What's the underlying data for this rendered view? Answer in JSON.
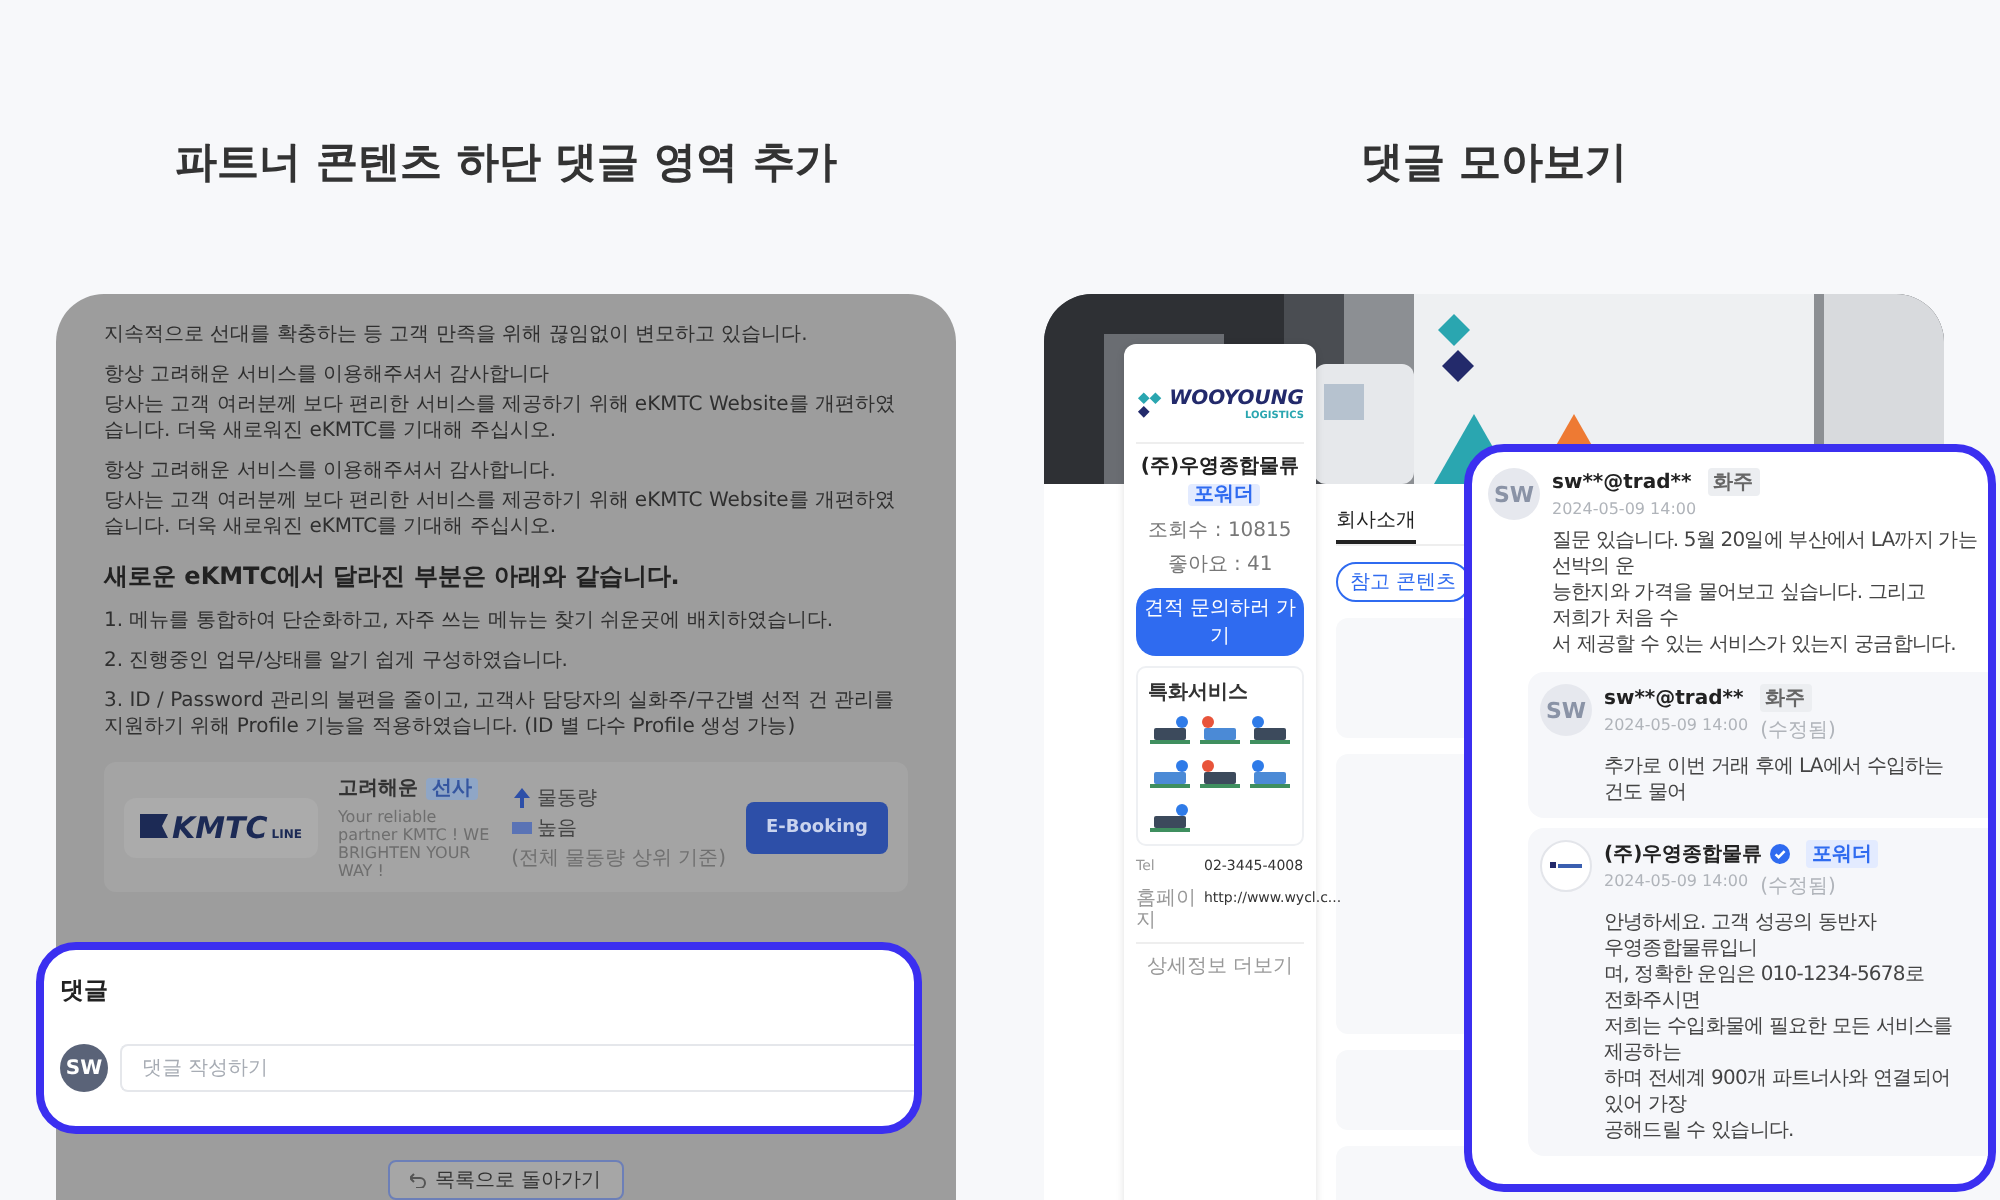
{
  "headings": [
    "파트너 콘텐츠 하단 댓글 영역 추가",
    "댓글 모아보기"
  ],
  "partner_content": {
    "paragraphs": [
      [
        "지속적으로 선대를 확충하는 등 고객 만족을 위해 끊임없이 변모하고 있습니다."
      ],
      [
        "항상 고려해운 서비스를 이용해주셔서 감사합니다",
        "당사는 고객 여러분께 보다 편리한 서비스를 제공하기 위해 eKMTC Website를 개편하였습니다. 더욱 새로워진 eKMTC를 기대해 주십시오."
      ],
      [
        "항상 고려해운 서비스를 이용해주셔서 감사합니다.",
        "당사는 고객 여러분께 보다 편리한 서비스를 제공하기 위해 eKMTC Website를 개편하였습니다. 더욱 새로워진 eKMTC를 기대해 주십시오."
      ]
    ],
    "section_title": "새로운 eKMTC에서 달라진 부분은 아래와 같습니다.",
    "list": [
      "1. 메뉴를 통합하여 단순화하고, 자주 쓰는 메뉴는 찾기 쉬운곳에 배치하였습니다.",
      "2. 진행중인 업무/상태를 알기 쉽게 구성하였습니다.",
      "3. ID / Password 관리의 불편을 줄이고, 고객사 담당자의 실화주/구간별 선적 건 관리를 지원하기 위해 Profile 기능을 적용하였습니다. (ID 별 다수 Profile 생성 가능)"
    ],
    "partner_card": {
      "logo": "KMTC",
      "logo_suffix": "LINE",
      "name": "고려해운",
      "badge": "선사",
      "tagline": "Your reliable partner KMTC !   WE BRIGHTEN YOUR WAY !",
      "volume_label": "물동량",
      "volume_value": "높음",
      "volume_note": "(전체 물동량 상위 기준)",
      "button": "E-Booking"
    },
    "comment_section": {
      "title": "댓글",
      "avatar": "SW",
      "placeholder": "댓글 작성하기"
    },
    "back_button": "목록으로 돌아가기"
  },
  "comments_overview": {
    "profile": {
      "logo": "WOOYOUNG",
      "logo_sub": "LOGISTICS",
      "name": "(주)우영종합물류",
      "badge": "포워더",
      "views": "조회수 : 10815",
      "likes": "좋아요 : 41",
      "quote_button": "견적 문의하러 가기",
      "services_title": "특화서비스",
      "tel_label": "Tel",
      "tel": "02-3445-4008",
      "homepage_label": "홈페이지",
      "homepage": "http://www.wycl.c...",
      "more": "상세정보 더보기"
    },
    "tabs": [
      {
        "label": "회사소개",
        "selected": true
      }
    ],
    "chips": [
      {
        "label": "참고 콘텐츠",
        "selected": true
      }
    ],
    "highlight": [
      {
        "kind": "user",
        "avatar": "SW",
        "author": "sw**@trad**",
        "badge": "화주",
        "date": "2024-05-09 14:00",
        "lines": [
          "질문 있습니다. 5월 20일에 부산에서 LA까지 가는 선박의 운",
          "능한지와 가격을 물어보고 싶습니다. 그리고 저희가 처음 수",
          "서 제공할 수 있는 서비스가 있는지 궁금합니다."
        ],
        "replies": [
          {
            "kind": "user",
            "avatar": "SW",
            "author": "sw**@trad**",
            "badge": "화주",
            "date": "2024-05-09 14:00",
            "edited": "(수정됨)",
            "lines": [
              "추가로 이번 거래 후에 LA에서 수입하는 건도 물어"
            ]
          },
          {
            "kind": "company",
            "author": "(주)우영종합물류",
            "badge": "포워더",
            "date": "2024-05-09 14:00",
            "edited": "(수정됨)",
            "lines": [
              "안녕하세요. 고객 성공의 동반자 우영종합물류입니",
              "며, 정확한 운임은 010-1234-5678로 전화주시면",
              "저희는 수입화물에 필요한 모든 서비스를 제공하는",
              "하며 전세계 900개 파트너사와 연결되어 있어 가장",
              "공해드릴 수 있습니다."
            ]
          }
        ]
      }
    ]
  }
}
